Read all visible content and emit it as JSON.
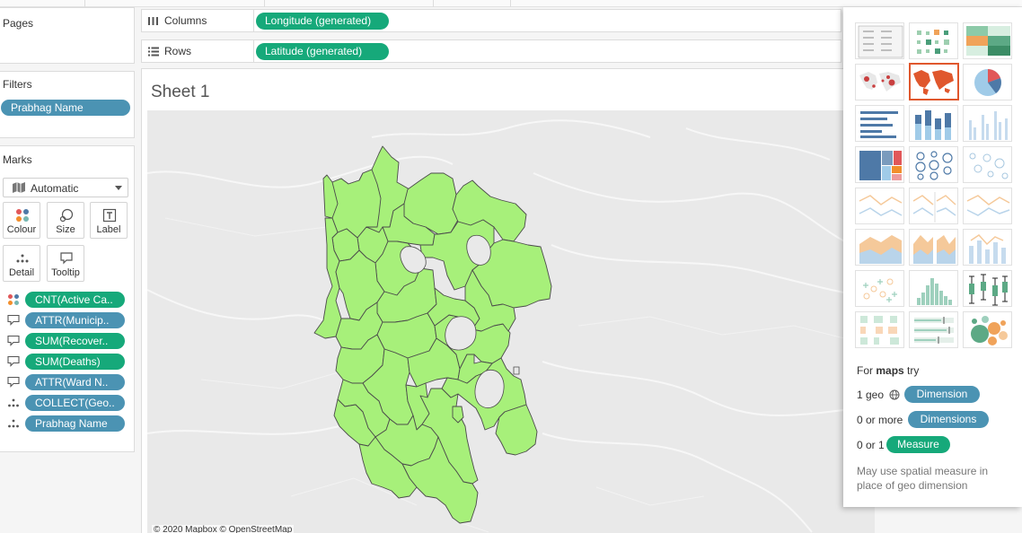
{
  "pages": {
    "title": "Pages"
  },
  "filters": {
    "title": "Filters",
    "items": [
      "Prabhag Name"
    ]
  },
  "marks": {
    "title": "Marks",
    "mark_type": "Automatic",
    "buttons": {
      "colour": "Colour",
      "size": "Size",
      "label": "Label",
      "detail": "Detail",
      "tooltip": "Tooltip"
    },
    "fields": [
      {
        "label": "CNT(Active Ca..",
        "kind": "colour",
        "color": "green"
      },
      {
        "label": "ATTR(Municip..",
        "kind": "tooltip",
        "color": "blue"
      },
      {
        "label": "SUM(Recover..",
        "kind": "tooltip",
        "color": "green"
      },
      {
        "label": "SUM(Deaths)",
        "kind": "tooltip",
        "color": "green"
      },
      {
        "label": "ATTR(Ward N..",
        "kind": "tooltip",
        "color": "blue"
      },
      {
        "label": "COLLECT(Geo..",
        "kind": "detail",
        "color": "blue"
      },
      {
        "label": "Prabhag Name",
        "kind": "detail",
        "color": "blue"
      }
    ]
  },
  "shelves": {
    "columns_label": "Columns",
    "columns_pill": "Longitude (generated)",
    "rows_label": "Rows",
    "rows_pill": "Latitude (generated)"
  },
  "sheet": {
    "title": "Sheet 1"
  },
  "map": {
    "attribution": "© 2020 Mapbox © OpenStreetMap",
    "fill_color": "#a7f07a",
    "outline_color": "#555555",
    "background_color": "#e9e9e9"
  },
  "show_me": {
    "heading_pre": "For ",
    "heading_bold": "maps",
    "heading_post": " try",
    "geo_label": "1 geo",
    "geo_pill": "Dimension",
    "dims_label": "0 or more",
    "dims_pill": "Dimensions",
    "measure_label": "0 or 1",
    "measure_pill": "Measure",
    "note": "May use spatial measure in place of geo dimension",
    "accent": "#e0572d"
  }
}
